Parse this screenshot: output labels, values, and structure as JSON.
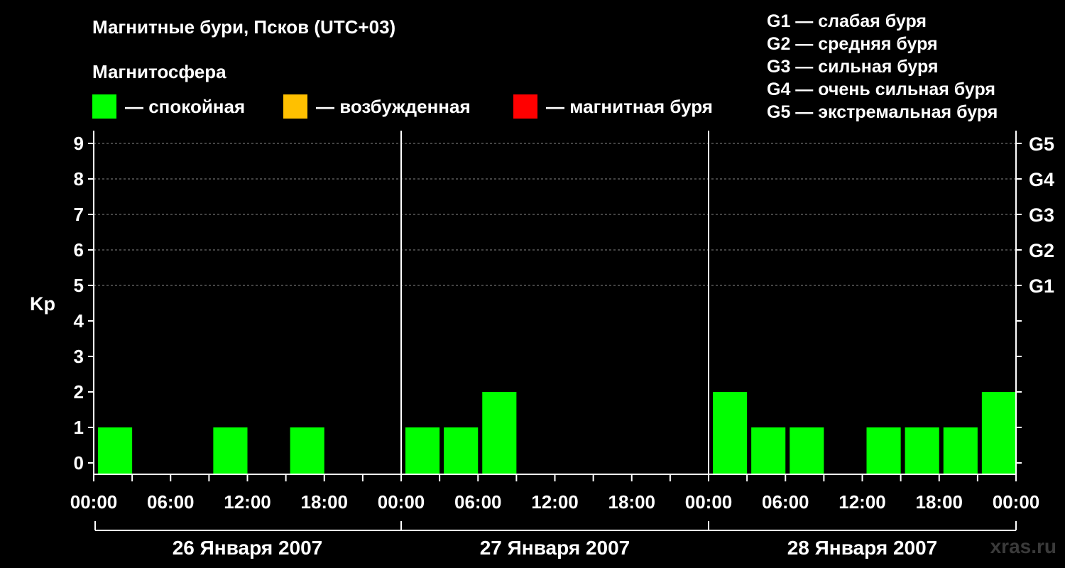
{
  "header": {
    "title": "Магнитные бури, Псков (UTC+03)",
    "subtitle": "Магнитосфера"
  },
  "legend": [
    {
      "label": "— спокойная",
      "color": "#00ff00"
    },
    {
      "label": "— возбужденная",
      "color": "#ffc000"
    },
    {
      "label": "— магнитная буря",
      "color": "#ff0000"
    }
  ],
  "storm_scale": [
    "G1 — слабая буря",
    "G2 — средняя буря",
    "G3 — сильная буря",
    "G4 — очень сильная буря",
    "G5 — экстремальная буря"
  ],
  "watermark": "xras.ru",
  "chart_data": {
    "type": "bar",
    "ylabel": "Kp",
    "ylim": [
      0,
      9
    ],
    "yticks": [
      "0",
      "1",
      "2",
      "3",
      "4",
      "5",
      "6",
      "7",
      "8",
      "9"
    ],
    "right_ticks": [
      {
        "value": 5,
        "label": "G1"
      },
      {
        "value": 6,
        "label": "G2"
      },
      {
        "value": 7,
        "label": "G3"
      },
      {
        "value": 8,
        "label": "G4"
      },
      {
        "value": 9,
        "label": "G5"
      }
    ],
    "x_tick_labels": [
      "00:00",
      "06:00",
      "12:00",
      "18:00",
      "00:00",
      "06:00",
      "12:00",
      "18:00",
      "00:00",
      "06:00",
      "12:00",
      "18:00",
      "00:00"
    ],
    "days": [
      "26 Января 2007",
      "27 Января 2007",
      "28 Января 2007"
    ],
    "bar_color": "#00ff00",
    "grid": "dashed at 5-9",
    "values": [
      [
        1,
        0,
        0,
        1,
        0,
        1,
        0,
        0
      ],
      [
        1,
        1,
        2,
        0,
        0,
        0,
        0,
        0
      ],
      [
        2,
        1,
        1,
        0,
        1,
        1,
        1,
        2
      ]
    ]
  }
}
